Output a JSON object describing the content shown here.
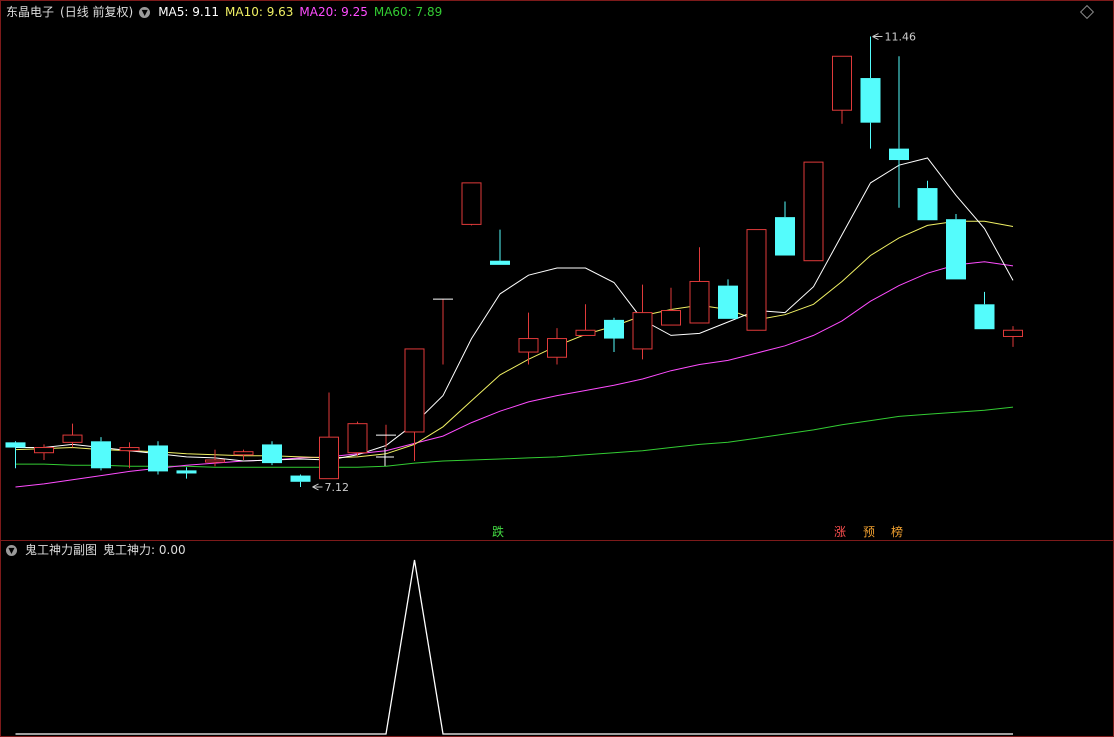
{
  "header": {
    "stock_name": "东晶电子",
    "period": "(日线 前复权)",
    "ma5_label": "MA5:",
    "ma5_value": "9.11",
    "ma10_label": "MA10:",
    "ma10_value": "9.63",
    "ma20_label": "MA20:",
    "ma20_value": "9.25",
    "ma60_label": "MA60:",
    "ma60_value": "7.89"
  },
  "sub_header": {
    "title": "鬼工神力副图",
    "indicator_label": "鬼工神力:",
    "indicator_value": "0.00"
  },
  "signals": {
    "fall": "跌",
    "rise": "涨",
    "pre": "预",
    "board": "榜"
  },
  "colors": {
    "up": "#e03a3a",
    "down": "#54fcfc",
    "ma5": "#ffffff",
    "ma10": "#f0f064",
    "ma20": "#ff4cff",
    "ma60": "#33cc33",
    "frame": "#7d1a1a",
    "signal_fall": "#44dd44",
    "signal_rise": "#ff5050",
    "signal_other": "#f0a030"
  },
  "chart_data": {
    "type": "candlestick",
    "price_range": [
      6.85,
      11.6
    ],
    "high_annotation": "11.46",
    "low_annotation": "7.12",
    "candles": [
      {
        "o": 7.55,
        "c": 7.5,
        "h": 7.56,
        "l": 7.3
      },
      {
        "o": 7.45,
        "c": 7.5,
        "h": 7.53,
        "l": 7.38
      },
      {
        "o": 7.55,
        "c": 7.62,
        "h": 7.73,
        "l": 7.5
      },
      {
        "o": 7.56,
        "c": 7.3,
        "h": 7.6,
        "l": 7.28
      },
      {
        "o": 7.47,
        "c": 7.5,
        "h": 7.55,
        "l": 7.3
      },
      {
        "o": 7.52,
        "c": 7.27,
        "h": 7.56,
        "l": 7.24
      },
      {
        "o": 7.28,
        "c": 7.25,
        "h": 7.31,
        "l": 7.2
      },
      {
        "o": 7.36,
        "c": 7.38,
        "h": 7.48,
        "l": 7.32
      },
      {
        "o": 7.43,
        "c": 7.46,
        "h": 7.48,
        "l": 7.38
      },
      {
        "o": 7.53,
        "c": 7.35,
        "h": 7.56,
        "l": 7.33
      },
      {
        "o": 7.23,
        "c": 7.17,
        "h": 7.24,
        "l": 7.12
      },
      {
        "o": 7.2,
        "c": 7.6,
        "h": 8.03,
        "l": 7.2
      },
      {
        "o": 7.45,
        "c": 7.73,
        "h": 7.75,
        "l": 7.42
      },
      {
        "o": 7.62,
        "c": 7.62,
        "h": 7.72,
        "l": 7.5
      },
      {
        "o": 7.65,
        "c": 8.45,
        "h": 8.45,
        "l": 7.37
      },
      {
        "o": 8.93,
        "c": 8.93,
        "h": 8.93,
        "l": 8.3
      },
      {
        "o": 9.65,
        "c": 10.05,
        "h": 10.05,
        "l": 9.64
      },
      {
        "o": 9.3,
        "c": 9.26,
        "h": 9.6,
        "l": 9.26
      },
      {
        "o": 8.42,
        "c": 8.55,
        "h": 8.8,
        "l": 8.3
      },
      {
        "o": 8.37,
        "c": 8.55,
        "h": 8.65,
        "l": 8.3
      },
      {
        "o": 8.58,
        "c": 8.63,
        "h": 8.88,
        "l": 8.58
      },
      {
        "o": 8.73,
        "c": 8.55,
        "h": 8.75,
        "l": 8.42
      },
      {
        "o": 8.45,
        "c": 8.8,
        "h": 9.07,
        "l": 8.35
      },
      {
        "o": 8.68,
        "c": 8.82,
        "h": 9.04,
        "l": 8.68
      },
      {
        "o": 8.7,
        "c": 9.1,
        "h": 9.43,
        "l": 8.7
      },
      {
        "o": 9.06,
        "c": 8.74,
        "h": 9.12,
        "l": 8.74
      },
      {
        "o": 8.63,
        "c": 9.6,
        "h": 9.6,
        "l": 8.63
      },
      {
        "o": 9.72,
        "c": 9.35,
        "h": 9.87,
        "l": 9.35
      },
      {
        "o": 9.3,
        "c": 10.25,
        "h": 10.25,
        "l": 9.3
      },
      {
        "o": 10.75,
        "c": 11.27,
        "h": 11.27,
        "l": 10.62
      },
      {
        "o": 11.06,
        "c": 10.63,
        "h": 11.46,
        "l": 10.38
      },
      {
        "o": 10.38,
        "c": 10.27,
        "h": 11.27,
        "l": 9.81
      },
      {
        "o": 10.0,
        "c": 9.69,
        "h": 10.07,
        "l": 9.69
      },
      {
        "o": 9.7,
        "c": 9.12,
        "h": 9.75,
        "l": 9.12
      },
      {
        "o": 8.88,
        "c": 8.64,
        "h": 9.0,
        "l": 8.64
      },
      {
        "o": 8.57,
        "c": 8.63,
        "h": 8.67,
        "l": 8.47
      }
    ],
    "ma5": [
      7.5,
      7.5,
      7.53,
      7.5,
      7.47,
      7.44,
      7.41,
      7.4,
      7.37,
      7.38,
      7.39,
      7.38,
      7.43,
      7.52,
      7.73,
      8.0,
      8.55,
      8.98,
      9.16,
      9.23,
      9.23,
      9.09,
      8.73,
      8.58,
      8.6,
      8.71,
      8.82,
      8.8,
      9.05,
      9.55,
      10.05,
      10.22,
      10.29,
      9.93,
      9.61,
      9.11
    ],
    "ma10": [
      7.48,
      7.49,
      7.5,
      7.48,
      7.47,
      7.46,
      7.44,
      7.43,
      7.42,
      7.42,
      7.41,
      7.4,
      7.41,
      7.44,
      7.53,
      7.7,
      7.95,
      8.2,
      8.35,
      8.48,
      8.59,
      8.67,
      8.77,
      8.83,
      8.87,
      8.83,
      8.73,
      8.78,
      8.88,
      9.1,
      9.35,
      9.52,
      9.64,
      9.68,
      9.68,
      9.63
    ],
    "ma20": [
      7.12,
      7.15,
      7.19,
      7.23,
      7.27,
      7.3,
      7.33,
      7.35,
      7.37,
      7.38,
      7.4,
      7.41,
      7.44,
      7.47,
      7.54,
      7.61,
      7.74,
      7.85,
      7.94,
      8.0,
      8.05,
      8.1,
      8.16,
      8.24,
      8.3,
      8.34,
      8.41,
      8.48,
      8.58,
      8.72,
      8.91,
      9.06,
      9.18,
      9.26,
      9.29,
      9.25
    ],
    "ma60": [
      7.34,
      7.34,
      7.33,
      7.33,
      7.32,
      7.32,
      7.32,
      7.31,
      7.31,
      7.31,
      7.31,
      7.31,
      7.31,
      7.32,
      7.35,
      7.37,
      7.38,
      7.39,
      7.4,
      7.41,
      7.43,
      7.45,
      7.47,
      7.5,
      7.53,
      7.55,
      7.59,
      7.63,
      7.67,
      7.72,
      7.76,
      7.8,
      7.82,
      7.84,
      7.86,
      7.89
    ],
    "sub_series": [
      0,
      0,
      0,
      0,
      0,
      0,
      0,
      0,
      0,
      0,
      0,
      0,
      0,
      0,
      0,
      0,
      0,
      0,
      0,
      0,
      0,
      0,
      0,
      0,
      0,
      0,
      0,
      0,
      0,
      0,
      0,
      0,
      0,
      0,
      0,
      0
    ],
    "sub_spike": {
      "index": 14,
      "value": 1.0
    }
  }
}
